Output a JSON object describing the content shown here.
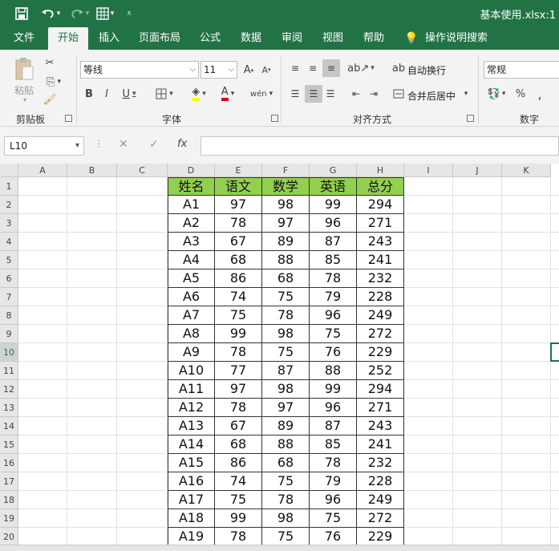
{
  "window": {
    "title": "基本使用.xlsx:1"
  },
  "quick_access": {
    "save_icon": "save-icon",
    "undo_icon": "undo-icon",
    "redo_icon": "redo-icon",
    "customize_icon": "customize-icon"
  },
  "tabs": [
    {
      "label": "文件"
    },
    {
      "label": "开始"
    },
    {
      "label": "插入"
    },
    {
      "label": "页面布局"
    },
    {
      "label": "公式"
    },
    {
      "label": "数据"
    },
    {
      "label": "审阅"
    },
    {
      "label": "视图"
    },
    {
      "label": "帮助"
    },
    {
      "label": "操作说明搜索"
    }
  ],
  "ribbon": {
    "clipboard": {
      "label": "剪贴板",
      "paste_label": "粘贴"
    },
    "font": {
      "label": "字体",
      "font_name": "等线",
      "font_size": "11"
    },
    "alignment": {
      "label": "对齐方式",
      "wrap_label": "自动换行",
      "merge_label": "合并后居中"
    },
    "number": {
      "label": "数字",
      "format": "常规",
      "percent": "%"
    }
  },
  "formula_bar": {
    "name_box": "L10",
    "fx": "fx",
    "content": ""
  },
  "columns": [
    "A",
    "B",
    "C",
    "D",
    "E",
    "F",
    "G",
    "H",
    "I",
    "J",
    "K"
  ],
  "rows": [
    "1",
    "2",
    "3",
    "4",
    "5",
    "6",
    "7",
    "8",
    "9",
    "10",
    "11",
    "12",
    "13",
    "14",
    "15",
    "16",
    "17",
    "18",
    "19",
    "20"
  ],
  "table": {
    "headers": [
      "姓名",
      "语文",
      "数学",
      "英语",
      "总分"
    ],
    "rows": [
      [
        "A1",
        "97",
        "98",
        "99",
        "294"
      ],
      [
        "A2",
        "78",
        "97",
        "96",
        "271"
      ],
      [
        "A3",
        "67",
        "89",
        "87",
        "243"
      ],
      [
        "A4",
        "68",
        "88",
        "85",
        "241"
      ],
      [
        "A5",
        "86",
        "68",
        "78",
        "232"
      ],
      [
        "A6",
        "74",
        "75",
        "79",
        "228"
      ],
      [
        "A7",
        "75",
        "78",
        "96",
        "249"
      ],
      [
        "A8",
        "99",
        "98",
        "75",
        "272"
      ],
      [
        "A9",
        "78",
        "75",
        "76",
        "229"
      ],
      [
        "A10",
        "77",
        "87",
        "88",
        "252"
      ],
      [
        "A11",
        "97",
        "98",
        "99",
        "294"
      ],
      [
        "A12",
        "78",
        "97",
        "96",
        "271"
      ],
      [
        "A13",
        "67",
        "89",
        "87",
        "243"
      ],
      [
        "A14",
        "68",
        "88",
        "85",
        "241"
      ],
      [
        "A15",
        "86",
        "68",
        "78",
        "232"
      ],
      [
        "A16",
        "74",
        "75",
        "79",
        "228"
      ],
      [
        "A17",
        "75",
        "78",
        "96",
        "249"
      ],
      [
        "A18",
        "99",
        "98",
        "75",
        "272"
      ],
      [
        "A19",
        "78",
        "75",
        "76",
        "229"
      ]
    ]
  },
  "colors": {
    "accent": "#217346",
    "header_fill": "#92d050"
  }
}
